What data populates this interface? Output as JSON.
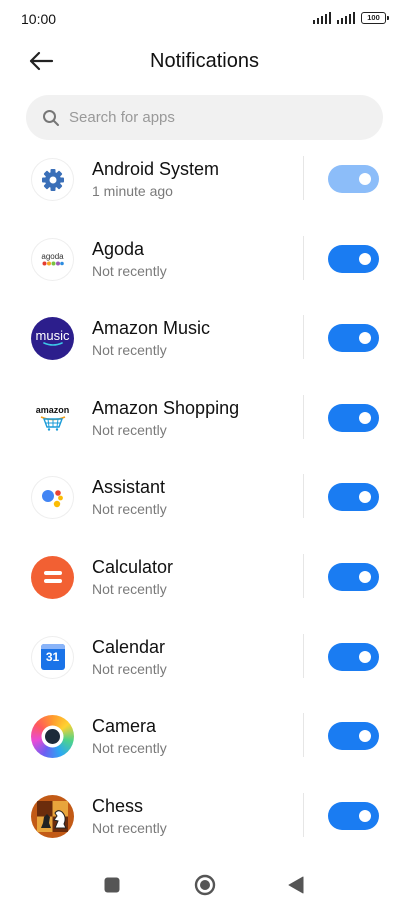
{
  "status": {
    "time": "10:00",
    "battery": "100"
  },
  "header": {
    "title": "Notifications"
  },
  "search": {
    "placeholder": "Search for apps"
  },
  "apps": [
    {
      "name": "Android System",
      "subtitle": "1 minute ago",
      "icon": "gear-icon",
      "enabled": true
    },
    {
      "name": "Agoda",
      "subtitle": "Not recently",
      "icon": "agoda-icon",
      "icon_text": "agoda",
      "enabled": true
    },
    {
      "name": "Amazon Music",
      "subtitle": "Not recently",
      "icon": "amazon-music-icon",
      "icon_text": "music",
      "enabled": true
    },
    {
      "name": "Amazon Shopping",
      "subtitle": "Not recently",
      "icon": "amazon-shopping-icon",
      "icon_text": "amazon",
      "enabled": true
    },
    {
      "name": "Assistant",
      "subtitle": "Not recently",
      "icon": "assistant-icon",
      "enabled": true
    },
    {
      "name": "Calculator",
      "subtitle": "Not recently",
      "icon": "calculator-icon",
      "enabled": true
    },
    {
      "name": "Calendar",
      "subtitle": "Not recently",
      "icon": "calendar-icon",
      "icon_text": "31",
      "enabled": true
    },
    {
      "name": "Camera",
      "subtitle": "Not recently",
      "icon": "camera-icon",
      "enabled": true
    },
    {
      "name": "Chess",
      "subtitle": "Not recently",
      "icon": "chess-icon",
      "enabled": true
    }
  ],
  "colors": {
    "toggle_on": "#1a7cf2",
    "toggle_disabled": "#8cbdf9",
    "search_bg": "#f1f1f1"
  }
}
